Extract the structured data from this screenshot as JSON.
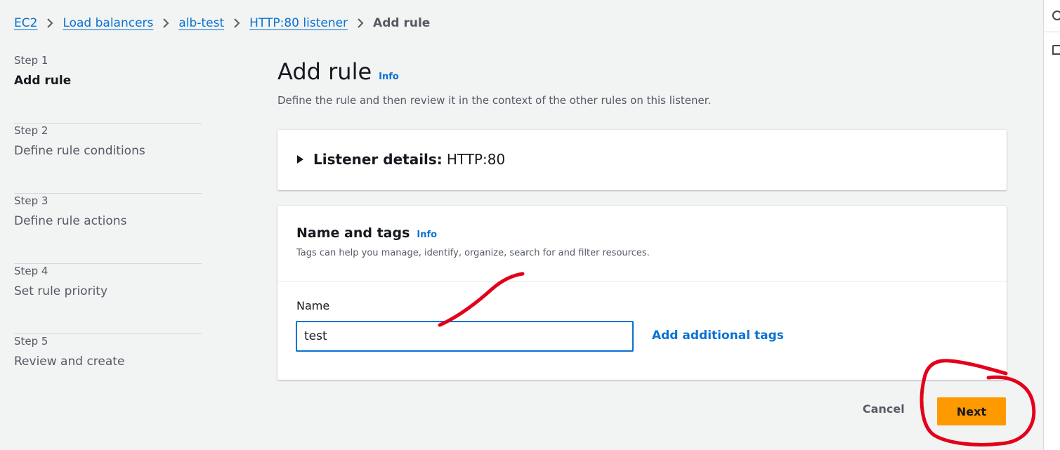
{
  "breadcrumb": {
    "items": [
      "EC2",
      "Load balancers",
      "alb-test",
      "HTTP:80 listener"
    ],
    "current": "Add rule"
  },
  "steps": [
    {
      "num": "Step 1",
      "title": "Add rule",
      "active": true
    },
    {
      "num": "Step 2",
      "title": "Define rule conditions",
      "active": false
    },
    {
      "num": "Step 3",
      "title": "Define rule actions",
      "active": false
    },
    {
      "num": "Step 4",
      "title": "Set rule priority",
      "active": false
    },
    {
      "num": "Step 5",
      "title": "Review and create",
      "active": false
    }
  ],
  "page": {
    "title": "Add rule",
    "info": "Info",
    "description": "Define the rule and then review it in the context of the other rules on this listener."
  },
  "listener": {
    "label": "Listener details:",
    "value": "HTTP:80"
  },
  "tags": {
    "title": "Name and tags",
    "info": "Info",
    "description": "Tags can help you manage, identify, organize, search for and filter resources.",
    "name_label": "Name",
    "name_value": "test",
    "add_tags": "Add additional tags"
  },
  "actions": {
    "cancel": "Cancel",
    "next": "Next"
  },
  "colors": {
    "link": "#0972d3",
    "primary_button": "#ff9900",
    "annotation": "#e3001b"
  }
}
